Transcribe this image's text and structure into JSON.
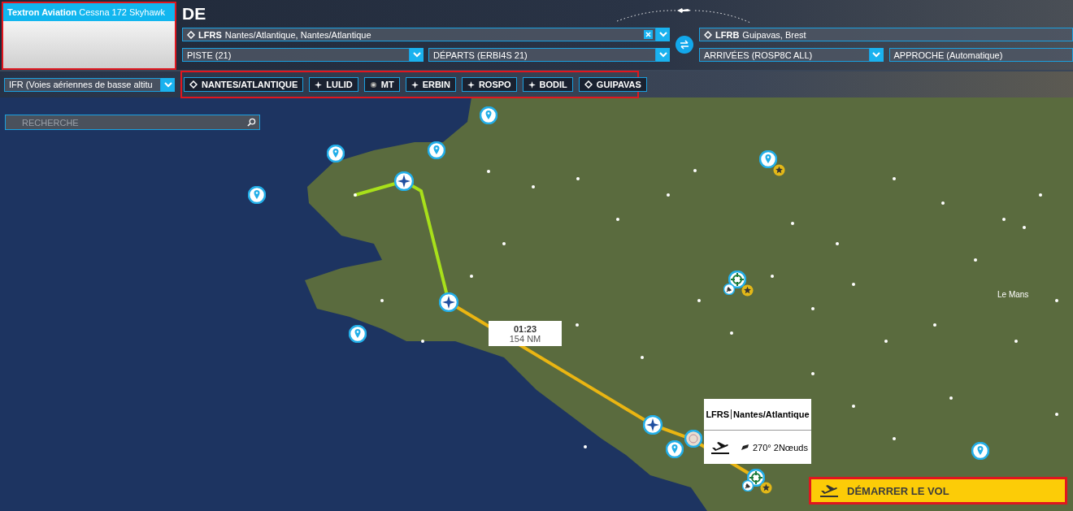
{
  "aircraft": {
    "title": "**Textron Aviation** Cessna 172 Skyhawk"
  },
  "heading": "DE",
  "departure": {
    "code": "LFRS",
    "name": "Nantes/Atlantique, Nantes/Atlantique"
  },
  "arrival": {
    "code": "LFRB",
    "name": "Guipavas, Brest"
  },
  "departure_selects": [
    {
      "label": "PISTE (21)",
      "caret": true
    },
    {
      "label": "DÉPARTS (ERBI4S 21)",
      "caret": true
    }
  ],
  "arrival_selects": [
    {
      "label": "ARRIVÉES (ROSP8C ALL)",
      "caret": true
    },
    {
      "label": "APPROCHE (Automatique)",
      "caret": false
    }
  ],
  "flight_rules": "IFR (Voies aériennes de basse altitu",
  "waypoints": [
    {
      "label": "NANTES/ATLANTIQUE",
      "kind": "airport"
    },
    {
      "label": "LULID",
      "kind": "fix"
    },
    {
      "label": "MT",
      "kind": "vor"
    },
    {
      "label": "ERBIN",
      "kind": "fix"
    },
    {
      "label": "ROSPO",
      "kind": "fix"
    },
    {
      "label": "BODIL",
      "kind": "fix"
    },
    {
      "label": "GUIPAVAS",
      "kind": "airport"
    }
  ],
  "search": {
    "placeholder": "RECHERCHE"
  },
  "route_label": {
    "time": "01:23",
    "distance": "154 NM"
  },
  "airport_popup": {
    "code": "LFRS",
    "name": "Nantes/Atlantique",
    "wind": "270° 2Nœuds"
  },
  "map_labels": [
    "Le Mans"
  ],
  "start_button": "DÉMARRER LE VOL"
}
